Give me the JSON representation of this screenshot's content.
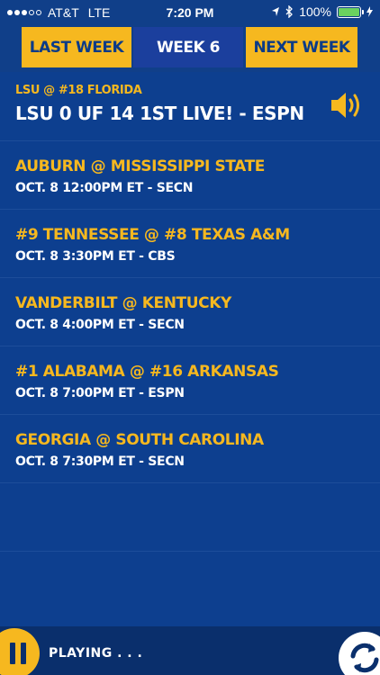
{
  "status_bar": {
    "carrier": "AT&T",
    "network": "LTE",
    "time": "7:20 PM",
    "battery": "100%",
    "icons": [
      "signal-dots",
      "location-arrow-icon",
      "bluetooth-icon",
      "battery-icon",
      "charging-bolt-icon"
    ]
  },
  "week_nav": {
    "prev_label": "LAST WEEK",
    "current_label": "WEEK 6",
    "next_label": "NEXT WEEK"
  },
  "live_game": {
    "matchup": "LSU @ #18 FLORIDA",
    "score": "LSU 0 UF 14 1ST LIVE! - ESPN",
    "icon": "speaker-volume-icon"
  },
  "games": [
    {
      "matchup": "AUBURN @ MISSISSIPPI STATE",
      "detail": "OCT. 8 12:00PM ET - SECN"
    },
    {
      "matchup": "#9 TENNESSEE @ #8 TEXAS A&M",
      "detail": "OCT. 8 3:30PM ET - CBS"
    },
    {
      "matchup": "VANDERBILT @ KENTUCKY",
      "detail": "OCT. 8 4:00PM ET - SECN"
    },
    {
      "matchup": "#1 ALABAMA @ #16 ARKANSAS",
      "detail": "OCT. 8 7:00PM ET - ESPN"
    },
    {
      "matchup": "GEORGIA @ SOUTH CAROLINA",
      "detail": "OCT. 8 7:30PM ET - SECN"
    }
  ],
  "player": {
    "status": "PLAYING . . .",
    "icons": [
      "pause-icon",
      "refresh-icon"
    ]
  },
  "colors": {
    "background": "#0d3f8f",
    "accent": "#f6b81f",
    "text": "#ffffff",
    "player_bar": "#0a2f6c"
  }
}
